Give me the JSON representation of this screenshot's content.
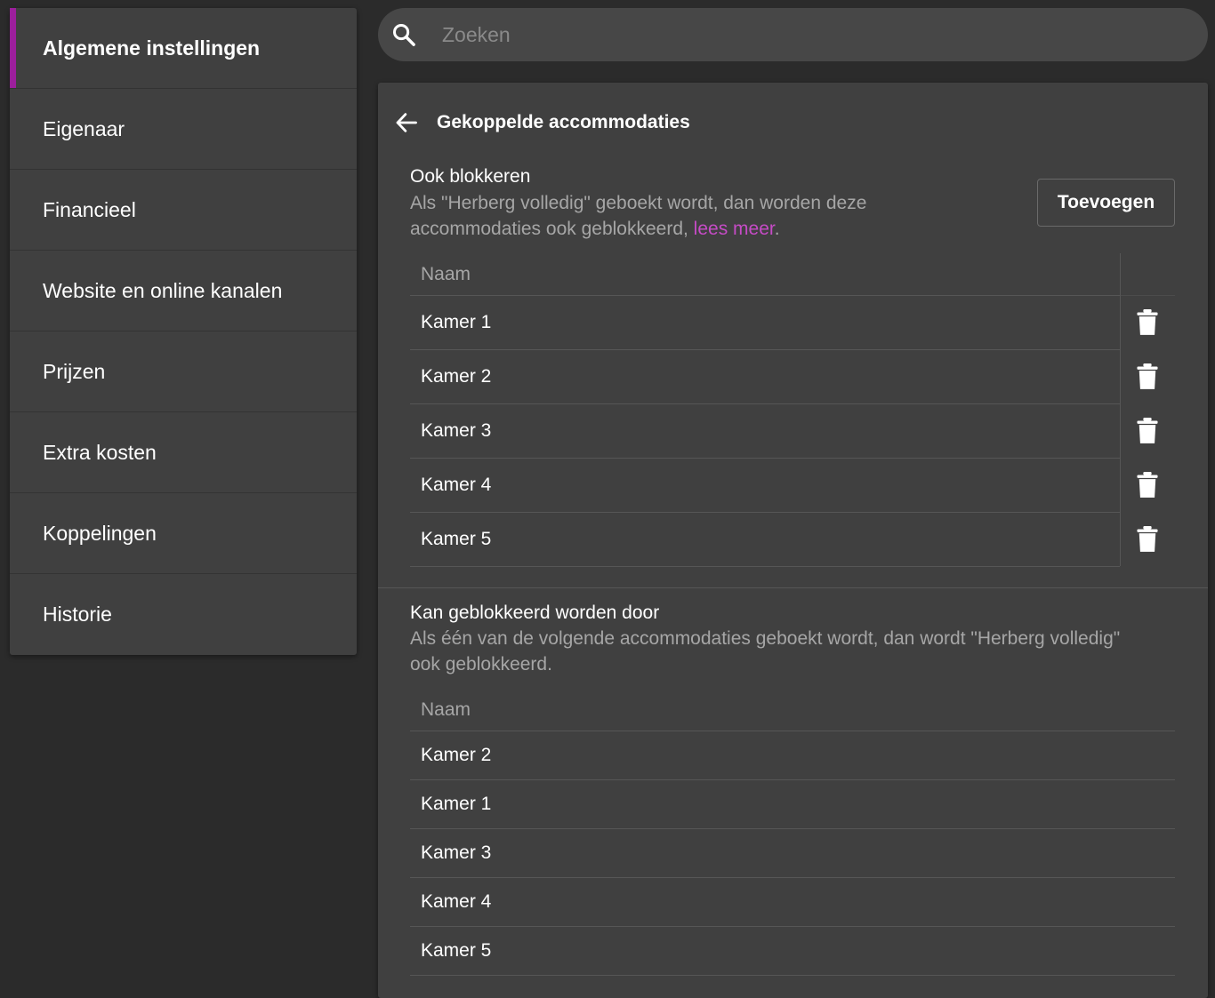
{
  "sidebar": {
    "items": [
      {
        "label": "Algemene instellingen",
        "active": true
      },
      {
        "label": "Eigenaar"
      },
      {
        "label": "Financieel"
      },
      {
        "label": "Website en online kanalen"
      },
      {
        "label": "Prijzen"
      },
      {
        "label": "Extra kosten"
      },
      {
        "label": "Koppelingen"
      },
      {
        "label": "Historie"
      }
    ]
  },
  "search": {
    "placeholder": "Zoeken",
    "icon": "search-icon"
  },
  "panel": {
    "title": "Gekoppelde accommodaties",
    "back_icon": "arrow-left-icon",
    "block": {
      "title": "Ook blokkeren",
      "desc_line1": "Als \"Herberg volledig\" geboekt wordt, dan worden deze",
      "desc_line2_pre": "accommodaties ook geblokkeerd, ",
      "link": "lees meer",
      "desc_line2_post": ".",
      "add_label": "Toevoegen",
      "column_name": "Naam",
      "rows": [
        "Kamer 1",
        "Kamer 2",
        "Kamer 3",
        "Kamer 4",
        "Kamer 5"
      ],
      "row_icon": "trash-icon"
    },
    "blocked_by": {
      "title": "Kan geblokkeerd worden door",
      "desc_line1": "Als één van de volgende accommodaties geboekt wordt, dan wordt \"Herberg volledig\"",
      "desc_line2": "ook geblokkeerd.",
      "column_name": "Naam",
      "rows": [
        "Kamer 2",
        "Kamer 1",
        "Kamer 3",
        "Kamer 4",
        "Kamer 5"
      ]
    }
  },
  "colors": {
    "accent": "#9c1f9c",
    "link": "#c64bc6",
    "background": "#2b2b2b",
    "panel": "#404040"
  }
}
